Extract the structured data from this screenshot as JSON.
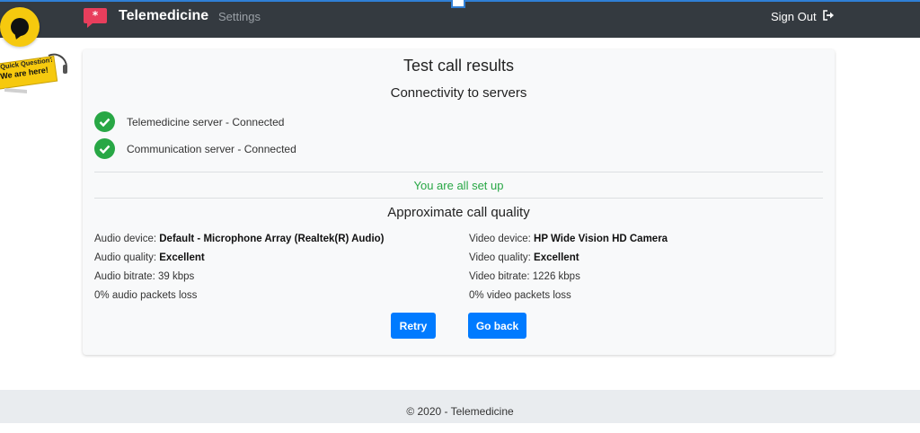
{
  "navbar": {
    "brand": "Telemedicine",
    "settings_label": "Settings",
    "signout_label": "Sign Out",
    "colors": {
      "background": "#343a40",
      "brand_icon": "#e83e5c"
    }
  },
  "chat_widget": {
    "banner_line1": "Quick Question?",
    "banner_line2": "We are here!",
    "color": "#f6c90e"
  },
  "card": {
    "title": "Test call results",
    "connectivity_title": "Connectivity to servers",
    "servers": [
      {
        "label": "Telemedicine server - Connected"
      },
      {
        "label": "Communication server - Connected"
      }
    ],
    "setup_message": "You are all set up",
    "quality_title": "Approximate call quality",
    "audio": {
      "device_label": "Audio device:",
      "device_value": "Default - Microphone Array (Realtek(R) Audio)",
      "quality_label": "Audio quality:",
      "quality_value": "Excellent",
      "bitrate": "Audio bitrate: 39 kbps",
      "packet_loss": "0% audio packets loss"
    },
    "video": {
      "device_label": "Video device:",
      "device_value": "HP Wide Vision HD Camera",
      "quality_label": "Video quality:",
      "quality_value": "Excellent",
      "bitrate": "Video bitrate: 1226 kbps",
      "packet_loss": "0% video packets loss"
    },
    "retry_label": "Retry",
    "goback_label": "Go back"
  },
  "footer": {
    "text": "© 2020 - Telemedicine"
  },
  "colors": {
    "accent": "#007bff",
    "success": "#28a745"
  }
}
